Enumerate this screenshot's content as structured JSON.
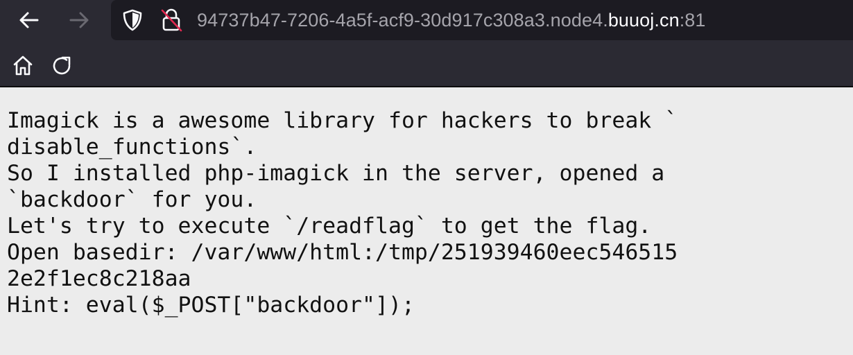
{
  "browser": {
    "url": {
      "prefix": "94737b47-7206-4a5f-acf9-30d917c308a3.node4.",
      "host": "buuoj.cn",
      "port": ":81"
    },
    "icons": [
      "back-arrow-icon",
      "forward-arrow-icon",
      "shield-icon",
      "insecure-lock-icon",
      "home-icon",
      "reload-icon"
    ],
    "colors": {
      "toolbar": "#2b2a33",
      "urlbar": "#1c1b22",
      "page_background": "#ececec",
      "url_dim_text": "#a5a4ab",
      "url_host_text": "#fbfbfe",
      "insecure_strike": "#e22850"
    }
  },
  "page": {
    "lines": [
      "Imagick is a awesome library for hackers to break `",
      "disable_functions`.",
      "So I installed php-imagick in the server, opened a",
      "`backdoor` for you.",
      "Let's try to execute `/readflag` to get the flag.",
      "Open basedir: /var/www/html:/tmp/251939460eec546515",
      "2e2f1ec8c218aa",
      "Hint: eval($_POST[\"backdoor\"]);"
    ]
  }
}
